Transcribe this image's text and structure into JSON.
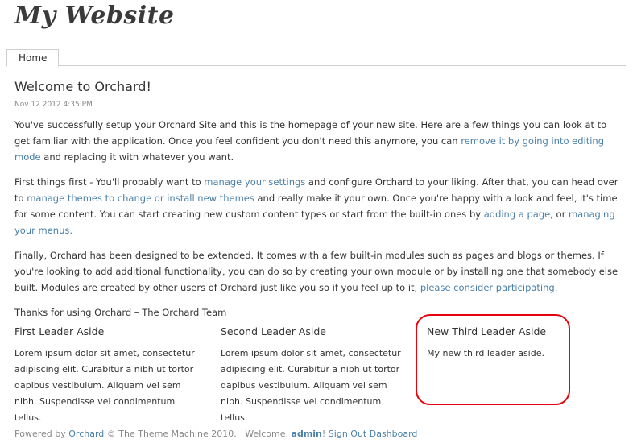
{
  "header": {
    "site_title": "My Website"
  },
  "nav": {
    "tabs": [
      {
        "label": "Home"
      }
    ]
  },
  "main": {
    "title": "Welcome to Orchard!",
    "date": "Nov 12 2012 4:35 PM",
    "p1": {
      "text_a": "You've successfully setup your Orchard Site and this is the homepage of your new site. Here are a few things you can look at to get familiar with the application. Once you feel confident you don't need this anymore, you can ",
      "link_1": "remove it by going into editing mode",
      "text_b": " and replacing it with whatever you want."
    },
    "p2": {
      "text_a": "First things first - You'll probably want to ",
      "link_1": "manage your settings",
      "text_b": " and configure Orchard to your liking. After that, you can head over to ",
      "link_2": "manage themes to change or install new themes",
      "text_c": " and really make it your own. Once you're happy with a look and feel, it's time for some content. You can start creating new custom content types or start from the built-in ones by ",
      "link_3": "adding a page",
      "text_d": ", or ",
      "link_4": "managing your menus.",
      "text_e": ""
    },
    "p3": {
      "text_a": "Finally, Orchard has been designed to be extended. It comes with a few built-in modules such as pages and blogs or themes. If you're looking to add additional functionality, you can do so by creating your own module or by installing one that somebody else built. Modules are created by other users of Orchard just like you so if you feel up to it, ",
      "link_1": "please consider participating",
      "text_b": "."
    },
    "p4": {
      "text": "Thanks for using Orchard – The Orchard Team"
    }
  },
  "asides": [
    {
      "title": "First Leader Aside",
      "body": "Lorem ipsum dolor sit amet, consectetur adipiscing elit. Curabitur a nibh ut tortor dapibus vestibulum. Aliquam vel sem nibh. Suspendisse vel condimentum tellus."
    },
    {
      "title": "Second Leader Aside",
      "body": "Lorem ipsum dolor sit amet, consectetur adipiscing elit. Curabitur a nibh ut tortor dapibus vestibulum. Aliquam vel sem nibh. Suspendisse vel condimentum tellus."
    },
    {
      "title": "New Third Leader Aside",
      "body": "My new third leader aside."
    }
  ],
  "footer": {
    "powered_by": "Powered by ",
    "orchard_link": "Orchard",
    "copyright": " © The Theme Machine 2010.",
    "welcome": "   Welcome, ",
    "user": "admin",
    "exclaim": "! ",
    "sign_out": "Sign Out",
    "dashboard": "Dashboard"
  },
  "colors": {
    "link": "#4a7fa8",
    "highlight": "#e8000a",
    "text": "#333333",
    "muted": "#888888"
  }
}
